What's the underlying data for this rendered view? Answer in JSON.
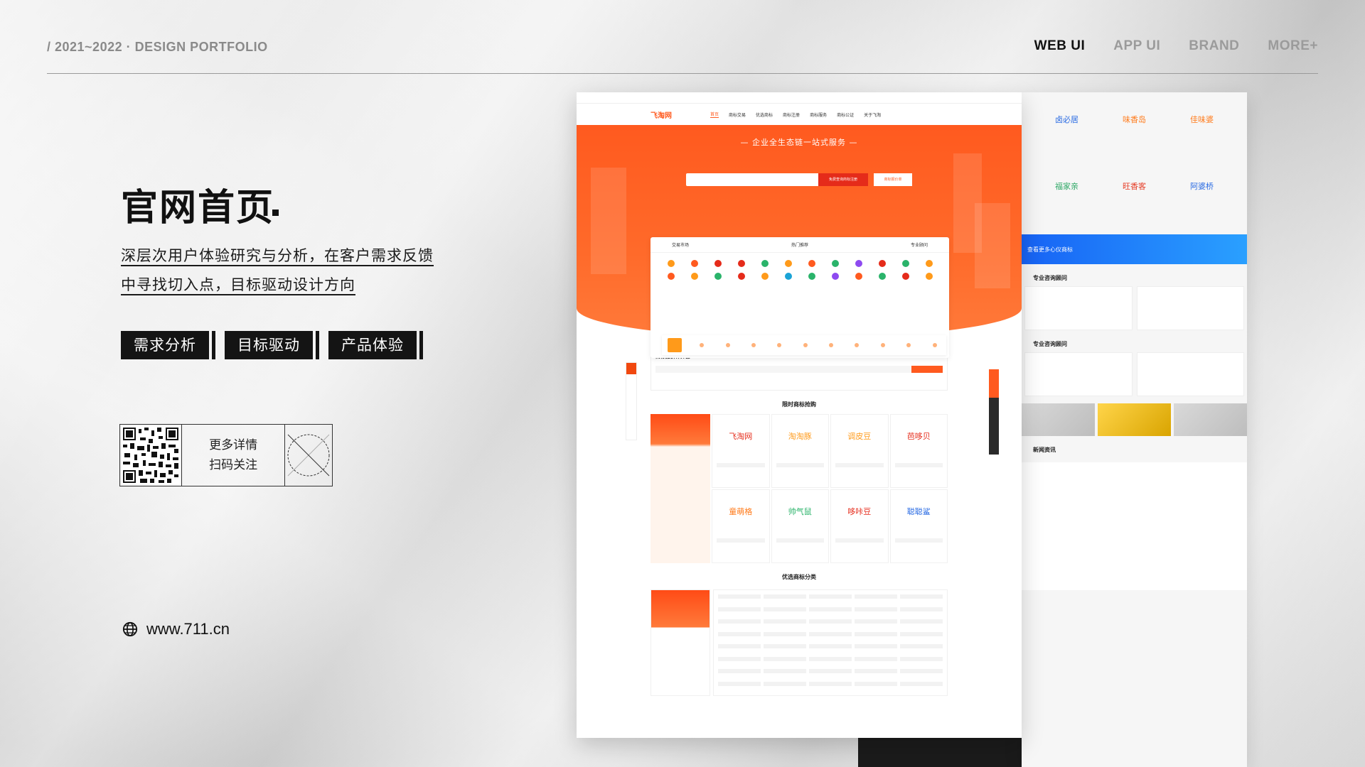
{
  "header": {
    "portfolio": "/ 2021~2022 · DESIGN PORTFOLIO",
    "nav": [
      {
        "label": "WEB UI",
        "active": true
      },
      {
        "label": "APP UI",
        "active": false
      },
      {
        "label": "BRAND",
        "active": false
      },
      {
        "label": "MORE+",
        "active": false
      }
    ]
  },
  "intro": {
    "title": "官网首页",
    "lines": [
      "深层次用户体验研究与分析，在客户需求反馈",
      "中寻找切入点，目标驱动设计方向"
    ],
    "tags": [
      "需求分析",
      "目标驱动",
      "产品体验"
    ]
  },
  "qr": {
    "line1": "更多详情",
    "line2": "扫码关注"
  },
  "website": "www.711.cn",
  "mockup": {
    "logo": "飞淘网",
    "nav": [
      "首页",
      "商标交易",
      "优选商标",
      "商标注册",
      "商标服务",
      "商标公证",
      "关于飞淘"
    ],
    "hero_title": "— 企业全生态链一站式服务 —",
    "search_button": "免费查询商标注册",
    "search_button2": "商标报价单",
    "panel_tabs": [
      "交易市场",
      "热门推荐",
      "专业顾问"
    ],
    "strip_items": [
      "商标转让",
      "商标注册",
      "版权登记",
      "专利申请",
      "商标续展",
      "商标变更",
      "商标许可",
      "商标异议",
      "商标驳回",
      "商标撤三",
      "商标监测"
    ],
    "calc_title": "商标报价计算器",
    "sections": {
      "limited": "限时商标抢购",
      "categories": "优选商标分类"
    },
    "cards": [
      "飞淘网",
      "淘淘豚",
      "调皮豆",
      "芭哆贝",
      "童萌格",
      "帅气鼠",
      "哆咔豆",
      "聪聪鲨"
    ],
    "back_names": [
      "卤必居",
      "味香岛",
      "佳味婆",
      "福家亲",
      "旺香客",
      "阿婆桥"
    ],
    "back_banner": "查看更多心仪商标",
    "back_sections": [
      "专业咨询顾问",
      "专业咨询顾问",
      "新闻资讯"
    ]
  },
  "colors": {
    "brand": "#ff5a1f",
    "accent_blue": "#1763f5",
    "text_dark": "#111111"
  }
}
